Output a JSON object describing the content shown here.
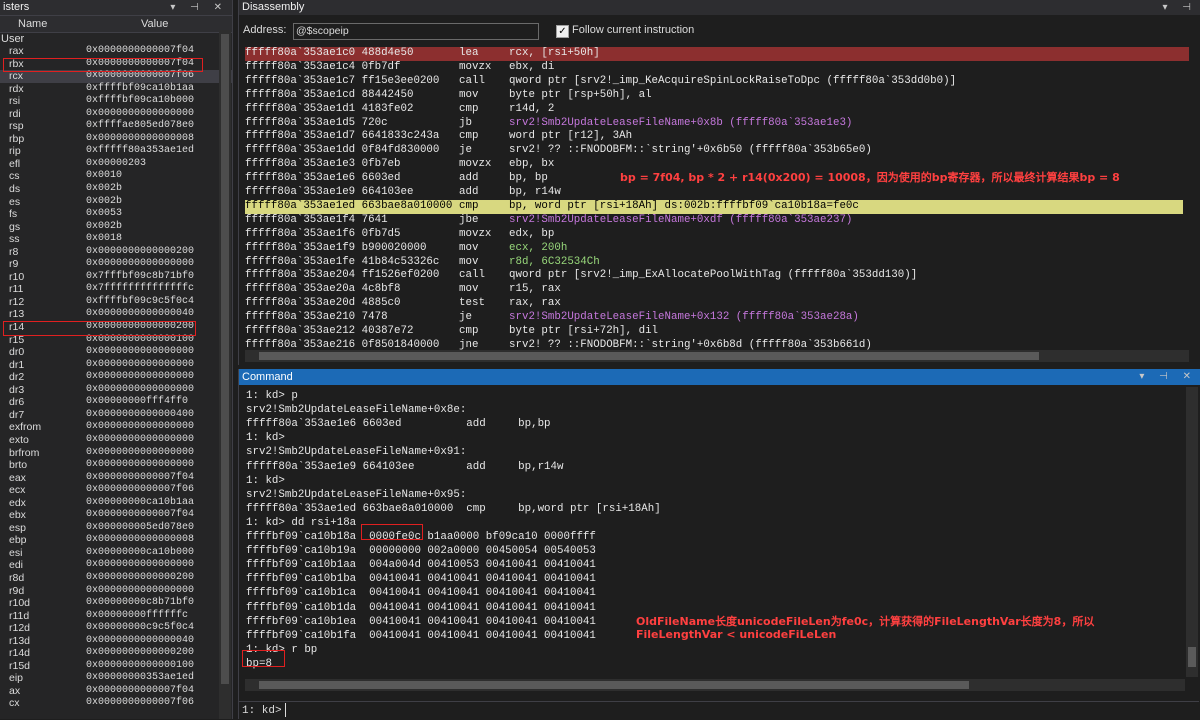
{
  "registers": {
    "title": "isters",
    "col_name": "Name",
    "col_value": "Value",
    "group": "User",
    "rows": [
      {
        "n": "rax",
        "v": "0x0000000000007f04"
      },
      {
        "n": "rbx",
        "v": "0x0000000000007f04"
      },
      {
        "n": "rcx",
        "v": "0x0000000000007f06"
      },
      {
        "n": "rdx",
        "v": "0xffffbf09ca10b1aa"
      },
      {
        "n": "rsi",
        "v": "0xffffbf09ca10b000"
      },
      {
        "n": "rdi",
        "v": "0x0000000000000000"
      },
      {
        "n": "rsp",
        "v": "0xffffae805ed078e0"
      },
      {
        "n": "rbp",
        "v": "0x0000000000000008"
      },
      {
        "n": "rip",
        "v": "0xfffff80a353ae1ed"
      },
      {
        "n": "efl",
        "v": "0x00000203"
      },
      {
        "n": "cs",
        "v": "0x0010"
      },
      {
        "n": "ds",
        "v": "0x002b"
      },
      {
        "n": "es",
        "v": "0x002b"
      },
      {
        "n": "fs",
        "v": "0x0053"
      },
      {
        "n": "gs",
        "v": "0x002b"
      },
      {
        "n": "ss",
        "v": "0x0018"
      },
      {
        "n": "r8",
        "v": "0x0000000000000200"
      },
      {
        "n": "r9",
        "v": "0x0000000000000000"
      },
      {
        "n": "r10",
        "v": "0x7fffbf09c8b71bf0"
      },
      {
        "n": "r11",
        "v": "0x7ffffffffffffffc"
      },
      {
        "n": "r12",
        "v": "0xffffbf09c9c5f0c4"
      },
      {
        "n": "r13",
        "v": "0x0000000000000040"
      },
      {
        "n": "r14",
        "v": "0x0000000000000200"
      },
      {
        "n": "r15",
        "v": "0x0000000000000100"
      },
      {
        "n": "dr0",
        "v": "0x0000000000000000"
      },
      {
        "n": "dr1",
        "v": "0x0000000000000000"
      },
      {
        "n": "dr2",
        "v": "0x0000000000000000"
      },
      {
        "n": "dr3",
        "v": "0x0000000000000000"
      },
      {
        "n": "dr6",
        "v": "0x00000000fff4ff0"
      },
      {
        "n": "dr7",
        "v": "0x0000000000000400"
      },
      {
        "n": "exfrom",
        "v": "0x0000000000000000"
      },
      {
        "n": "exto",
        "v": "0x0000000000000000"
      },
      {
        "n": "brfrom",
        "v": "0x0000000000000000"
      },
      {
        "n": "brto",
        "v": "0x0000000000000000"
      },
      {
        "n": "eax",
        "v": "0x0000000000007f04"
      },
      {
        "n": "ecx",
        "v": "0x0000000000007f06"
      },
      {
        "n": "edx",
        "v": "0x00000000ca10b1aa"
      },
      {
        "n": "ebx",
        "v": "0x0000000000007f04"
      },
      {
        "n": "esp",
        "v": "0x000000005ed078e0"
      },
      {
        "n": "ebp",
        "v": "0x0000000000000008"
      },
      {
        "n": "esi",
        "v": "0x00000000ca10b000"
      },
      {
        "n": "edi",
        "v": "0x0000000000000000"
      },
      {
        "n": "r8d",
        "v": "0x0000000000000200"
      },
      {
        "n": "r9d",
        "v": "0x0000000000000000"
      },
      {
        "n": "r10d",
        "v": "0x00000000c8b71bf0"
      },
      {
        "n": "r11d",
        "v": "0x00000000ffffffc"
      },
      {
        "n": "r12d",
        "v": "0x00000000c9c5f0c4"
      },
      {
        "n": "r13d",
        "v": "0x0000000000000040"
      },
      {
        "n": "r14d",
        "v": "0x0000000000000200"
      },
      {
        "n": "r15d",
        "v": "0x0000000000000100"
      },
      {
        "n": "eip",
        "v": "0x00000000353ae1ed"
      },
      {
        "n": "ax",
        "v": "0x0000000000007f04"
      },
      {
        "n": "cx",
        "v": "0x0000000000007f06"
      }
    ]
  },
  "disassembly": {
    "title": "Disassembly",
    "address_label": "Address:",
    "address_value": "@$scopeip",
    "follow_checked": "✓",
    "follow_label": "Follow current instruction",
    "lines": [
      {
        "a": "fffff80a`353ae1c0 488d4e50",
        "op": "lea",
        "ar": "rcx, [rsi+50h]"
      },
      {
        "a": "fffff80a`353ae1c4 0fb7df",
        "op": "movzx",
        "ar": "ebx, di"
      },
      {
        "a": "fffff80a`353ae1c7 ff15e3ee0200",
        "op": "call",
        "ar": "qword ptr [srv2!_imp_KeAcquireSpinLockRaiseToDpc (fffff80a`353dd0b0)]"
      },
      {
        "a": "fffff80a`353ae1cd 88442450",
        "op": "mov",
        "ar": "byte ptr [rsp+50h], al"
      },
      {
        "a": "fffff80a`353ae1d1 4183fe02",
        "op": "cmp",
        "ar": "r14d, 2"
      },
      {
        "a": "fffff80a`353ae1d5 720c",
        "op": "jb",
        "ar": "srv2!Smb2UpdateLeaseFileName+0x8b (fffff80a`353ae1e3)"
      },
      {
        "a": "fffff80a`353ae1d7 6641833c243a",
        "op": "cmp",
        "ar": "word ptr [r12], 3Ah"
      },
      {
        "a": "fffff80a`353ae1dd 0f84fd830000",
        "op": "je",
        "ar": "srv2! ?? ::FNODOBFM::`string'+0x6b50 (fffff80a`353b65e0)"
      },
      {
        "a": "fffff80a`353ae1e3 0fb7eb",
        "op": "movzx",
        "ar": "ebp, bx"
      },
      {
        "a": "fffff80a`353ae1e6 6603ed",
        "op": "add",
        "ar": "bp, bp"
      },
      {
        "a": "fffff80a`353ae1e9 664103ee",
        "op": "add",
        "ar": "bp, r14w"
      },
      {
        "a": "fffff80a`353ae1ed 663bae8a010000",
        "op": "cmp",
        "ar": "bp, word ptr [rsi+18Ah] ds:002b:ffffbf09`ca10b18a=fe0c"
      },
      {
        "a": "fffff80a`353ae1f4 7641",
        "op": "jbe",
        "ar": "srv2!Smb2UpdateLeaseFileName+0xdf (fffff80a`353ae237)"
      },
      {
        "a": "fffff80a`353ae1f6 0fb7d5",
        "op": "movzx",
        "ar": "edx, bp"
      },
      {
        "a": "fffff80a`353ae1f9 b900020000",
        "op": "mov",
        "ar": "ecx, 200h"
      },
      {
        "a": "fffff80a`353ae1fe 41b84c53326c",
        "op": "mov",
        "ar": "r8d, 6C32534Ch"
      },
      {
        "a": "fffff80a`353ae204 ff1526ef0200",
        "op": "call",
        "ar": "qword ptr [srv2!_imp_ExAllocatePoolWithTag (fffff80a`353dd130)]"
      },
      {
        "a": "fffff80a`353ae20a 4c8bf8",
        "op": "mov",
        "ar": "r15, rax"
      },
      {
        "a": "fffff80a`353ae20d 4885c0",
        "op": "test",
        "ar": "rax, rax"
      },
      {
        "a": "fffff80a`353ae210 7478",
        "op": "je",
        "ar": "srv2!Smb2UpdateLeaseFileName+0x132 (fffff80a`353ae28a)"
      },
      {
        "a": "fffff80a`353ae212 40387e72",
        "op": "cmp",
        "ar": "byte ptr [rsi+72h], dil"
      },
      {
        "a": "fffff80a`353ae216 0f8501840000",
        "op": "jne",
        "ar": "srv2! ?? ::FNODOBFM::`string'+0x6b8d (fffff80a`353b661d)"
      }
    ],
    "note": "bp = 7f04,  bp * 2 + r14(0x200) = 10008，因为使用的bp寄存器，所以最终计算结果bp = 8"
  },
  "command": {
    "title": "Command",
    "lines": [
      "1: kd> p",
      "srv2!Smb2UpdateLeaseFileName+0x8e:",
      "fffff80a`353ae1e6 6603ed          add     bp,bp",
      "1: kd>",
      "srv2!Smb2UpdateLeaseFileName+0x91:",
      "fffff80a`353ae1e9 664103ee        add     bp,r14w",
      "1: kd>",
      "srv2!Smb2UpdateLeaseFileName+0x95:",
      "fffff80a`353ae1ed 663bae8a010000  cmp     bp,word ptr [rsi+18Ah]",
      "1: kd> dd rsi+18a",
      "ffffbf09`ca10b18a  0000fe0c b1aa0000 bf09ca10 0000ffff",
      "ffffbf09`ca10b19a  00000000 002a0000 00450054 00540053",
      "ffffbf09`ca10b1aa  004a004d 00410053 00410041 00410041",
      "ffffbf09`ca10b1ba  00410041 00410041 00410041 00410041",
      "ffffbf09`ca10b1ca  00410041 00410041 00410041 00410041",
      "ffffbf09`ca10b1da  00410041 00410041 00410041 00410041",
      "ffffbf09`ca10b1ea  00410041 00410041 00410041 00410041",
      "ffffbf09`ca10b1fa  00410041 00410041 00410041 00410041",
      "1: kd> r bp",
      "bp=8"
    ],
    "note1": "OldFileName长度unicodeFileLen为fe0c，计算获得的FileLengthVar长度为8，所以",
    "note2": "FileLengthVar < unicodeFiLeLen",
    "prompt": "1: kd>"
  },
  "colors": {
    "current_line": "#8c2f2f",
    "highlight_line": "#d8d880",
    "symbol": "#c678dd",
    "number": "#98d87b",
    "annotation": "#ff4040",
    "command_title": "#1c6ab6"
  }
}
